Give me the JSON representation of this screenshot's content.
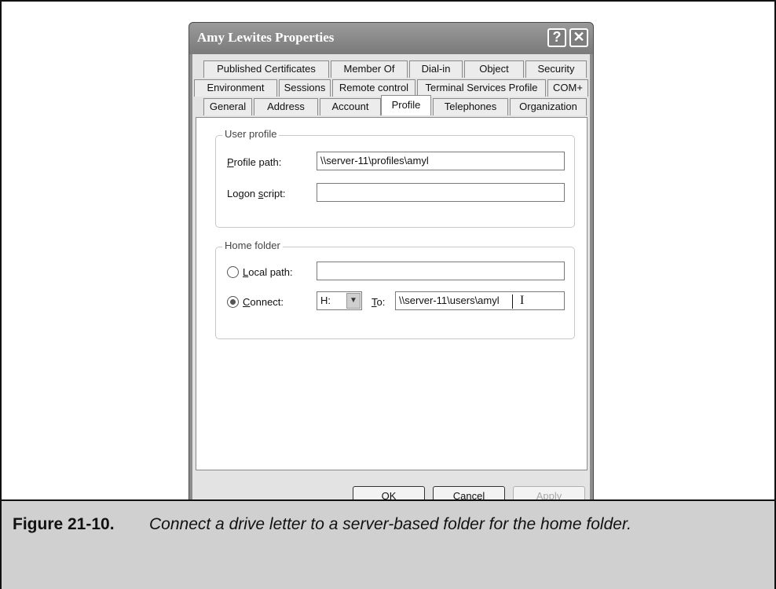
{
  "dialog": {
    "title": "Amy Lewites Properties",
    "help_glyph": "?",
    "close_glyph": "✕"
  },
  "tabs": {
    "row1": [
      "Published Certificates",
      "Member Of",
      "Dial-in",
      "Object",
      "Security"
    ],
    "row2": [
      "Environment",
      "Sessions",
      "Remote control",
      "Terminal Services Profile",
      "COM+"
    ],
    "row3": [
      "General",
      "Address",
      "Account",
      "Profile",
      "Telephones",
      "Organization"
    ],
    "active": "Profile"
  },
  "user_profile": {
    "legend": "User profile",
    "profile_path_label": [
      "",
      "P",
      "rofile path:"
    ],
    "profile_path_value": "\\\\server-11\\profiles\\amyl",
    "logon_script_label": [
      "Logon ",
      "s",
      "cript:"
    ],
    "logon_script_value": ""
  },
  "home_folder": {
    "legend": "Home folder",
    "local_path_label": [
      "",
      "L",
      "ocal path:"
    ],
    "local_path_value": "",
    "connect_label": [
      "",
      "C",
      "onnect:"
    ],
    "drive_value": "H:",
    "to_label": [
      "",
      "T",
      "o:"
    ],
    "to_value": "\\\\server-11\\users\\amyl",
    "cursor_glyph": "I"
  },
  "buttons": {
    "ok": "OK",
    "cancel": "Cancel",
    "apply": "Apply"
  },
  "caption": {
    "number": "Figure 21-10.",
    "text": "Connect a drive letter to a server-based folder for the home folder."
  }
}
